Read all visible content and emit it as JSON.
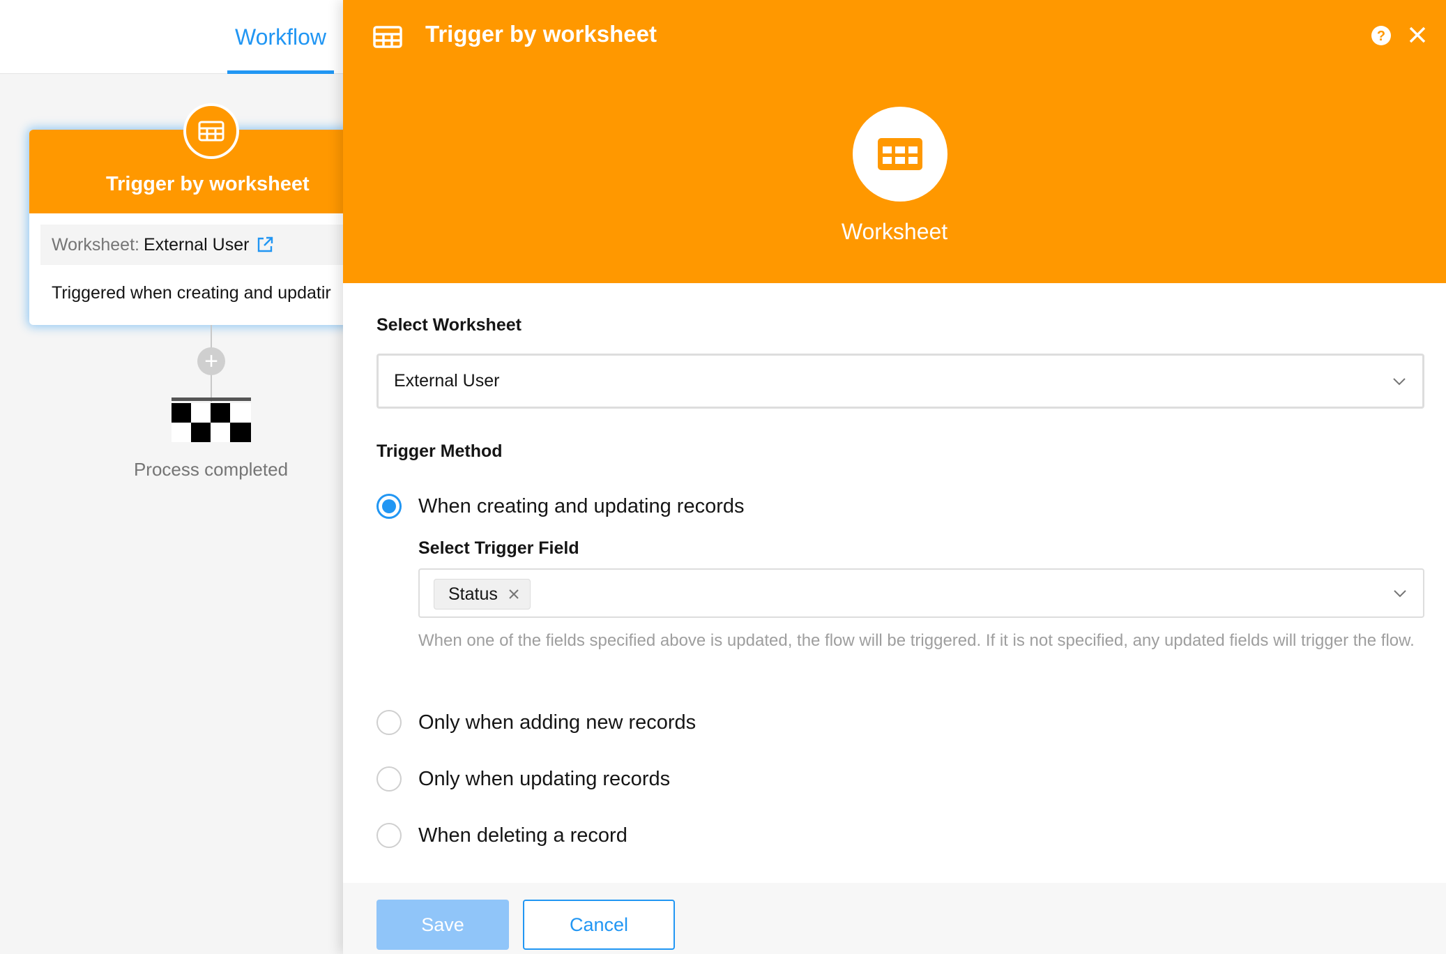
{
  "colors": {
    "accent": "#ff9800",
    "primary": "#2196f3",
    "muted": "#757575",
    "hint": "#9e9e9e"
  },
  "workflow_tab": {
    "label": "Workflow"
  },
  "node": {
    "title": "Trigger by worksheet",
    "worksheet_prefix": "Worksheet:",
    "worksheet_name": "External User",
    "description": "Triggered when creating and updatir",
    "icon": "grid-table-icon",
    "link_icon": "external-link-icon"
  },
  "end_node": {
    "label": "Process completed",
    "icon": "checkered-flag-icon"
  },
  "panel": {
    "title": "Trigger by worksheet",
    "hero_label": "Worksheet",
    "select_worksheet": {
      "label": "Select Worksheet",
      "value": "External User"
    },
    "trigger_method": {
      "label": "Trigger Method",
      "options": [
        {
          "label": "When creating and updating records",
          "checked": true
        },
        {
          "label": "Only when adding new records",
          "checked": false
        },
        {
          "label": "Only when updating records",
          "checked": false
        },
        {
          "label": "When deleting a record",
          "checked": false
        }
      ]
    },
    "trigger_field": {
      "label": "Select Trigger Field",
      "tags": [
        "Status"
      ],
      "hint": "When one of the fields specified above is updated, the flow will be triggered. If it is not specified, any updated fields will trigger the flow."
    },
    "buttons": {
      "save": "Save",
      "cancel": "Cancel"
    }
  }
}
